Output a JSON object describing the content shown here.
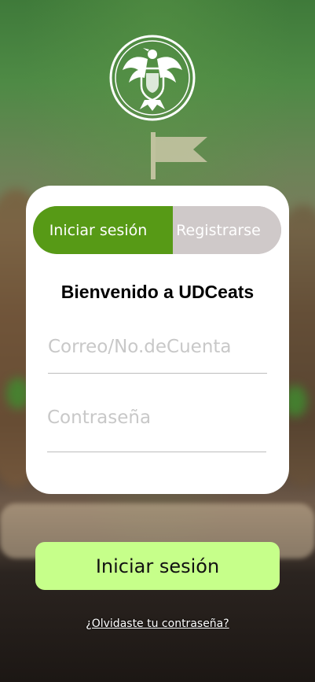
{
  "tabs": {
    "login_label": "Iniciar sesión",
    "register_label": "Registrarse"
  },
  "welcome_text": "Bienvenido a UDCeats",
  "form": {
    "email_placeholder": "Correo/No.deCuenta",
    "password_placeholder": "Contraseña"
  },
  "login_button_label": "Iniciar sesión",
  "forgot_password_link": "¿Olvidaste tu contraseña?",
  "icons": [
    "university-crest-icon",
    "flag-pick-icon"
  ],
  "colors": {
    "accent_green": "#579a16",
    "button_green": "#c6ff8a",
    "tab_inactive": "#cfc9c9"
  }
}
